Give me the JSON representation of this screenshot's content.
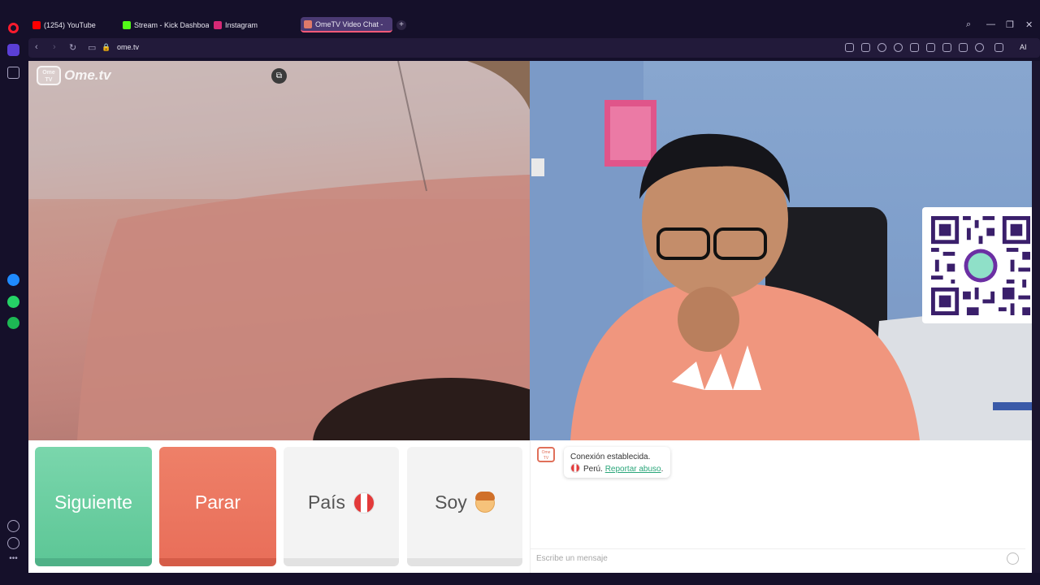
{
  "browser": {
    "tabs": [
      {
        "label": "(1254) YouTube",
        "icon_color": "#ff0000"
      },
      {
        "label": "Stream - Kick Dashboa",
        "icon_color": "#53fc18"
      },
      {
        "label": "Instagram",
        "icon_color": "#d62976"
      },
      {
        "label": "OmeTV Video Chat -",
        "icon_color": "#e07a6a"
      }
    ],
    "new_tab": "+",
    "url": "ome.tv",
    "ai_label": "AI"
  },
  "app": {
    "logo_text": "Ome.tv",
    "logo_badge": "Ome TV",
    "buttons": {
      "next": "Siguiente",
      "stop": "Parar",
      "country": "País",
      "gender": "Soy"
    },
    "chat": {
      "status": "Conexión establecida.",
      "country": "Perú.",
      "report_link": "Reportar abuso",
      "report_suffix": ".",
      "input_placeholder": "Escribe un mensaje"
    }
  },
  "colors": {
    "next_button": "#6dd0a2",
    "stop_button": "#ec775f",
    "link": "#2aa67a",
    "browser_bg": "#15102a"
  }
}
